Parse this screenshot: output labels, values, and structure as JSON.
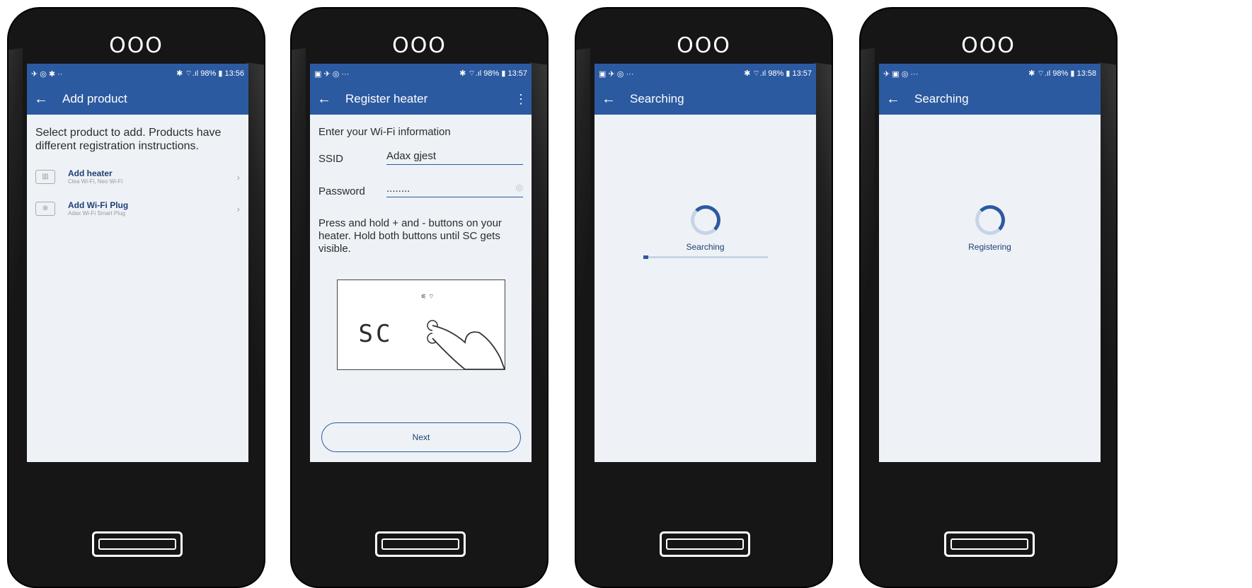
{
  "phones": [
    {
      "status_left": "✈ ◎ ✱ ··",
      "status_right": "✱ ⌔.ıl 98% ▮ 13:56",
      "title": "Add product",
      "intro": "Select product to add. Products have different registration instructions.",
      "items": [
        {
          "icon": "heater-icon",
          "name": "Add heater",
          "sub": "Clea Wi-Fi, Neo Wi-Fi"
        },
        {
          "icon": "plug-icon",
          "name": "Add Wi-Fi Plug",
          "sub": "Adax Wi-Fi Smart Plug"
        }
      ]
    },
    {
      "status_left": "▣ ✈ ◎ ···",
      "status_right": "✱ ⌔.ıl 98% ▮ 13:57",
      "title": "Register heater",
      "label": "Enter your Wi-Fi information",
      "ssid_label": "SSID",
      "ssid_value": "Adax gjest",
      "password_label": "Password",
      "password_value": "........",
      "instructions": "Press and hold + and - buttons on your heater. Hold both buttons until SC gets visible.",
      "display_text": "SC",
      "next_label": "Next"
    },
    {
      "status_left": "▣ ✈ ◎ ···",
      "status_right": "✱ ⌔.ıl 98% ▮ 13:57",
      "title": "Searching",
      "spinner_label": "Searching",
      "progress": 0.04
    },
    {
      "status_left": "✈ ▣ ◎ ···",
      "status_right": "✱ ⌔.ıl 98% ▮ 13:58",
      "title": "Searching",
      "spinner_label": "Registering"
    }
  ],
  "frame": {
    "top_dots": "OOO"
  },
  "colors": {
    "accent": "#2c5aa0",
    "screen_bg": "#eef2f7",
    "frame": "#161616"
  }
}
